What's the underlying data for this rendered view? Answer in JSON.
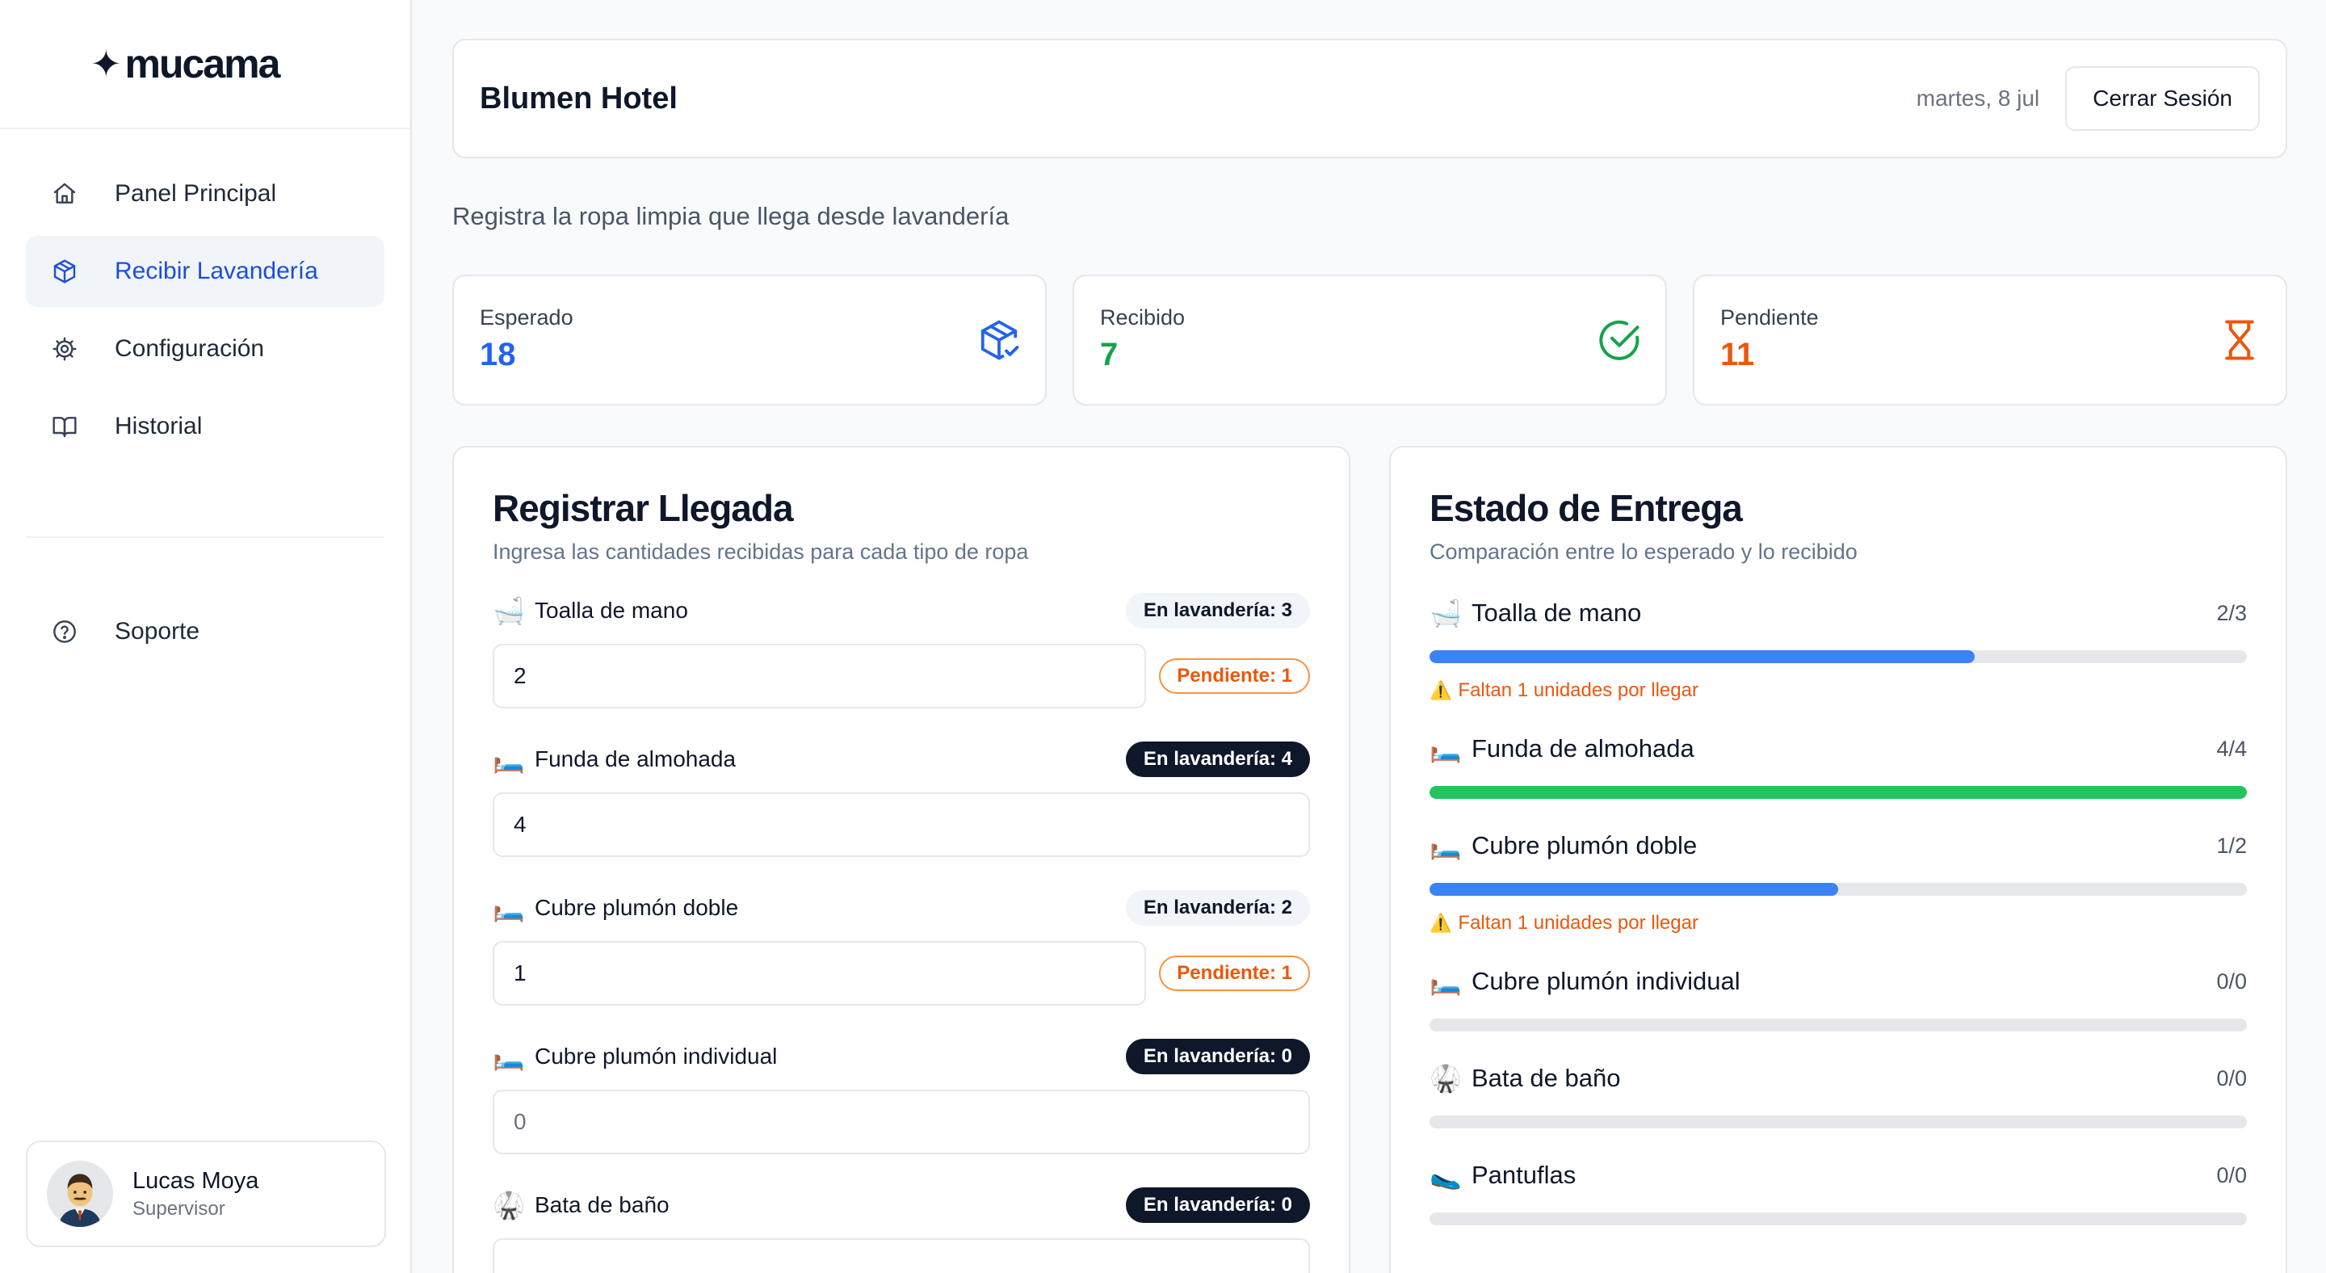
{
  "app": {
    "logo": "mucama",
    "logo_star": "✦"
  },
  "sidebar": {
    "items": [
      {
        "label": "Panel Principal",
        "icon": "home-icon",
        "active": false
      },
      {
        "label": "Recibir Lavandería",
        "icon": "package-icon",
        "active": true
      },
      {
        "label": "Configuración",
        "icon": "gear-icon",
        "active": false
      },
      {
        "label": "Historial",
        "icon": "book-icon",
        "active": false
      }
    ],
    "support": {
      "label": "Soporte",
      "icon": "help-circle-icon"
    },
    "user": {
      "name": "Lucas Moya",
      "role": "Supervisor"
    }
  },
  "header": {
    "title": "Blumen Hotel",
    "date": "martes, 8 jul",
    "logout_label": "Cerrar Sesión"
  },
  "page": {
    "subtitle": "Registra la ropa limpia que llega desde lavandería"
  },
  "stats": [
    {
      "label": "Esperado",
      "value": "18",
      "color": "#2563eb",
      "icon": "package-check-icon"
    },
    {
      "label": "Recibido",
      "value": "7",
      "color": "#16a34a",
      "icon": "check-circle-icon"
    },
    {
      "label": "Pendiente",
      "value": "11",
      "color": "#ea580c",
      "icon": "hourglass-icon"
    }
  ],
  "registrar": {
    "title": "Registrar Llegada",
    "subtitle": "Ingresa las cantidades recibidas para cada tipo de ropa",
    "items": [
      {
        "emoji": "🛁",
        "name": "Toalla de mano",
        "badge": "En lavandería: 3",
        "badge_style": "light",
        "value": "2",
        "pending": "Pendiente: 1"
      },
      {
        "emoji": "🛏️",
        "name": "Funda de almohada",
        "badge": "En lavandería: 4",
        "badge_style": "dark",
        "value": "4",
        "pending": ""
      },
      {
        "emoji": "🛏️",
        "name": "Cubre plumón doble",
        "badge": "En lavandería: 2",
        "badge_style": "light",
        "value": "1",
        "pending": "Pendiente: 1"
      },
      {
        "emoji": "🛏️",
        "name": "Cubre plumón individual",
        "badge": "En lavandería: 0",
        "badge_style": "dark",
        "value": "0",
        "pending": ""
      },
      {
        "emoji": "🥋",
        "name": "Bata de baño",
        "badge": "En lavandería: 0",
        "badge_style": "dark",
        "value": "",
        "pending": ""
      }
    ]
  },
  "estado": {
    "title": "Estado de Entrega",
    "subtitle": "Comparación entre lo esperado y lo recibido",
    "items": [
      {
        "emoji": "🛁",
        "name": "Toalla de mano",
        "count": "2/3",
        "progress": 0.667,
        "color": "#3b82f6",
        "warning": "Faltan 1 unidades por llegar"
      },
      {
        "emoji": "🛏️",
        "name": "Funda de almohada",
        "count": "4/4",
        "progress": 1.0,
        "color": "#22c55e",
        "warning": ""
      },
      {
        "emoji": "🛏️",
        "name": "Cubre plumón doble",
        "count": "1/2",
        "progress": 0.5,
        "color": "#3b82f6",
        "warning": "Faltan 1 unidades por llegar"
      },
      {
        "emoji": "🛏️",
        "name": "Cubre plumón individual",
        "count": "0/0",
        "progress": 0,
        "color": "#3b82f6",
        "warning": ""
      },
      {
        "emoji": "🥋",
        "name": "Bata de baño",
        "count": "0/0",
        "progress": 0,
        "color": "#3b82f6",
        "warning": ""
      },
      {
        "emoji": "🥿",
        "name": "Pantuflas",
        "count": "0/0",
        "progress": 0,
        "color": "#3b82f6",
        "warning": ""
      }
    ]
  }
}
